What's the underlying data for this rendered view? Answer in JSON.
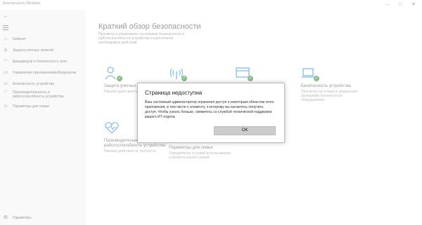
{
  "window": {
    "title": "Безопасность Windows"
  },
  "sidebar": {
    "back_icon": "←",
    "items": [
      {
        "icon": "home-icon",
        "glyph": "⌂",
        "label": "Кабинет"
      },
      {
        "icon": "person-icon",
        "glyph": "♙",
        "label": "Защита учетных записей"
      },
      {
        "icon": "wifi-icon",
        "glyph": "◠",
        "label": "Брандмауэр и безопасность сети"
      },
      {
        "icon": "browser-icon",
        "glyph": "▭",
        "label": "Управление приложениями/браузером"
      },
      {
        "icon": "laptop-icon",
        "glyph": "▱",
        "label": "Безопасность устройства"
      },
      {
        "icon": "heart-icon",
        "glyph": "♡",
        "label": "Производительность и работоспособность устройства"
      },
      {
        "icon": "family-icon",
        "glyph": "☺",
        "label": "Параметры для семьи"
      }
    ],
    "settings": {
      "glyph": "⚙",
      "label": "Параметры"
    }
  },
  "main": {
    "title": "Краткий обзор безопасности",
    "subtitle": "Просмотр и управление состоянием безопасности и работоспособности устройства и выполнение необходимых действий.",
    "tiles": [
      {
        "name": "Защита учетных записей",
        "desc": "Никаких действий не требуется."
      },
      {
        "name": "",
        "desc": ""
      },
      {
        "name": "",
        "desc": ""
      },
      {
        "name": "Безопасность устройства",
        "desc": "Просмотр состояния и управление функциями безопасности оборудования."
      },
      {
        "name": "Производительность и работоспособность устройства",
        "desc": "Никаких действий не требуется."
      },
      {
        "name": "Параметры для семьи",
        "desc": "Определение условий использования устройств вашей семьей."
      }
    ]
  },
  "dialog": {
    "title": "Страница недоступна",
    "message": "Ваш системный администратор ограничил доступ к некоторым областям этого приложения, в том числе к элементу, к которому вы пытаетесь получить доступ. Чтобы узнать больше, свяжитесь со службой технической поддержки вашего ИТ-отдела.",
    "ok_label": "ОК"
  },
  "colors": {
    "accent": "#0078d7",
    "ok_green": "#107c10"
  }
}
